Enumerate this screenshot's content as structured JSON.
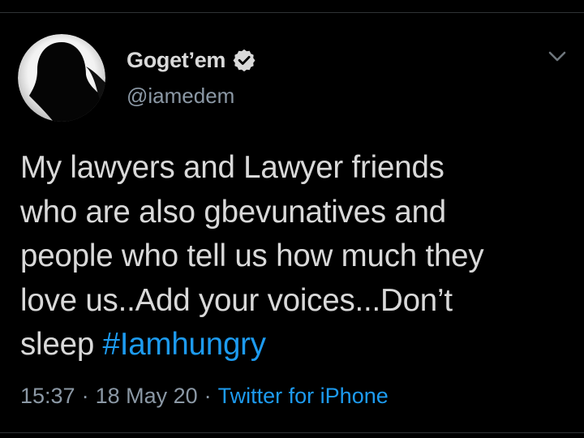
{
  "author": {
    "display_name": "Goget’em",
    "handle": "@iamedem",
    "verified": true
  },
  "icons": {
    "avatar": "profile-avatar",
    "verified": "verified-badge-icon",
    "menu": "chevron-down-icon"
  },
  "tweet": {
    "text": "My lawyers and Lawyer friends\nwho are also gbevunatives and\npeople who tell us how much they\nlove us..Add your voices...Don’t\nsleep ",
    "hashtag": "#Iamhungry"
  },
  "meta": {
    "time": "15:37",
    "separator": "·",
    "date": "18 May 20",
    "source": "Twitter for iPhone"
  },
  "colors": {
    "background": "#000000",
    "text": "#d9d9d9",
    "secondary_text": "#8b98a5",
    "link": "#1d9bf0",
    "divider": "#2f3336"
  }
}
